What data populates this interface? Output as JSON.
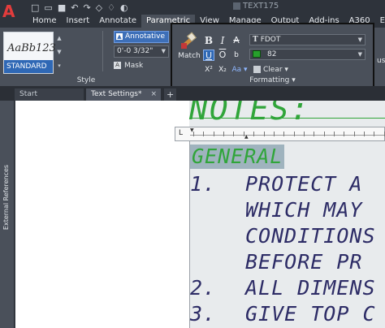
{
  "titlebar": {
    "doc_label": "TEXT175"
  },
  "menu": {
    "tabs": [
      "Home",
      "Insert",
      "Annotate",
      "Parametric",
      "View",
      "Manage",
      "Output",
      "Add-ins",
      "A360",
      "Express Too"
    ],
    "active_index": 3
  },
  "style_panel": {
    "preview_sample": "AaBb123",
    "style_name": "STANDARD",
    "annotative_label": "Annotative",
    "text_height": "0'-0 3/32\"",
    "mask_label": "Mask",
    "title": "Style"
  },
  "format_panel": {
    "match_label": "Match",
    "bold_label": "B",
    "italic_label": "I",
    "strike_label": "A",
    "underline_label": "U",
    "overline_label": "O",
    "case_label": "b",
    "sup_label": "X²",
    "sub_label": "X₂",
    "aa_label": "Aa ▾",
    "font_name": "FDOT",
    "font_icon": "T",
    "color_value": "82",
    "color_swatch": "#27a02c",
    "clear_label": "Clear ▾",
    "title": "Formatting ▾"
  },
  "right_clip": {
    "label": "ust"
  },
  "doc_tabs": {
    "start": "Start",
    "current": "Text Settings*",
    "close": "×",
    "add": "+"
  },
  "side_panel": {
    "label": "External References"
  },
  "canvas": {
    "title_text": "NOTES:",
    "selected_heading": "GENERAL",
    "lines": [
      {
        "num": "1.",
        "text": "PROTECT A"
      },
      {
        "num": "",
        "text": "WHICH MAY"
      },
      {
        "num": "",
        "text": "CONDITIONS"
      },
      {
        "num": "",
        "text": "BEFORE PR"
      },
      {
        "num": "2.",
        "text": "ALL DIMENS"
      },
      {
        "num": "3.",
        "text": "GIVE TOP C"
      }
    ]
  },
  "colors": {
    "accent_blue": "#2f68b5",
    "note_green": "#30a53a",
    "text_navy": "#2d2c66",
    "app_red": "#e23c3c"
  }
}
